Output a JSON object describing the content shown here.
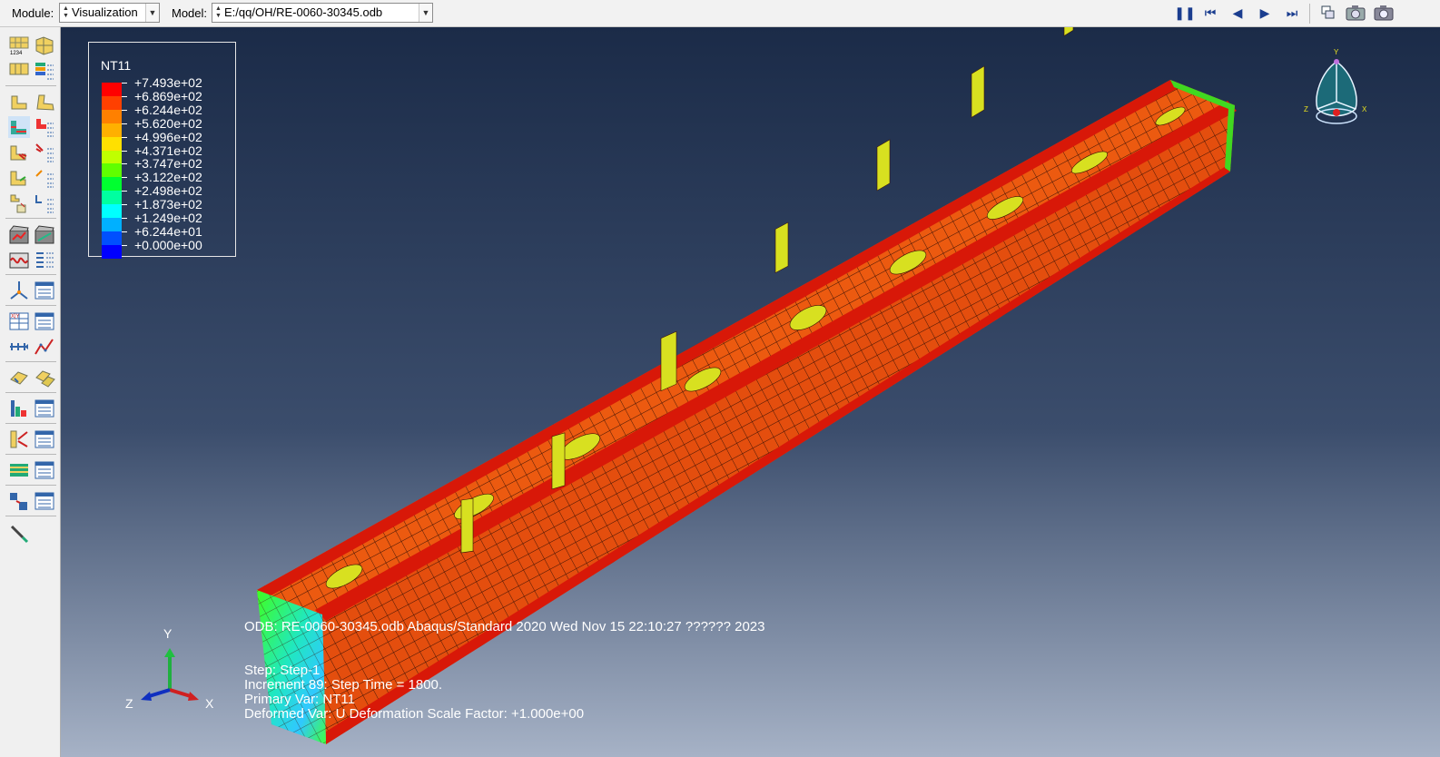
{
  "toolbar": {
    "module_label": "Module:",
    "module_value": "Visualization",
    "model_label": "Model:",
    "model_value": "E:/qq/OH/RE-0060-30345.odb"
  },
  "animation_controls": [
    "pause-icon",
    "first-frame-icon",
    "previous-frame-icon",
    "next-frame-icon",
    "last-frame-icon"
  ],
  "legend": {
    "title": "NT11",
    "entries": [
      {
        "value": "+7.493e+02",
        "color": "#ff0000"
      },
      {
        "value": "+6.869e+02",
        "color": "#ff4000"
      },
      {
        "value": "+6.244e+02",
        "color": "#ff8000"
      },
      {
        "value": "+5.620e+02",
        "color": "#ffb000"
      },
      {
        "value": "+4.996e+02",
        "color": "#ffe000"
      },
      {
        "value": "+4.371e+02",
        "color": "#c0ff00"
      },
      {
        "value": "+3.747e+02",
        "color": "#60ff00"
      },
      {
        "value": "+3.122e+02",
        "color": "#00ff30"
      },
      {
        "value": "+2.498e+02",
        "color": "#00ffa0"
      },
      {
        "value": "+1.873e+02",
        "color": "#00ffff"
      },
      {
        "value": "+1.249e+02",
        "color": "#00b0ff"
      },
      {
        "value": "+6.244e+01",
        "color": "#0050ff"
      },
      {
        "value": "+0.000e+00",
        "color": "#0000ff"
      }
    ]
  },
  "info": {
    "odb_line": "ODB: RE-0060-30345.odb    Abaqus/Standard 2020    Wed Nov 15 22:10:27 ?????? 2023",
    "step": "Step: Step-1",
    "increment": "Increment     89: Step Time =    1800.",
    "primary_var": "Primary Var: NT11",
    "deformed_var": "Deformed Var: U   Deformation Scale Factor: +1.000e+00"
  },
  "triad": {
    "x": "X",
    "y": "Y",
    "z": "Z"
  },
  "colors": {
    "viewport_top": "#1b2b48",
    "viewport_bottom": "#a6b2c6",
    "beam": "#e8500a",
    "beam_edge": "#d81e0a",
    "spot": "#d8e020"
  }
}
